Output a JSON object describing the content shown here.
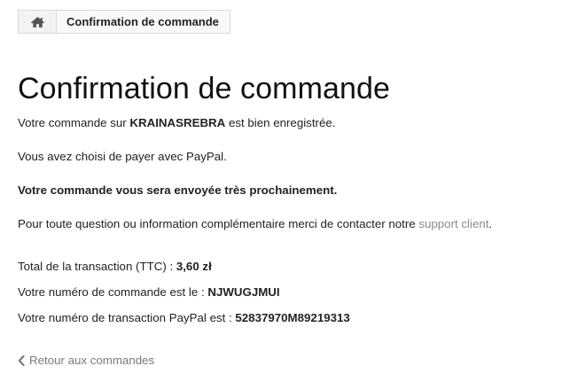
{
  "breadcrumb": {
    "home_icon": "home-icon",
    "current": "Confirmation de commande"
  },
  "title": "Confirmation de commande",
  "intro": {
    "prefix": "Votre commande sur ",
    "shop": "KRAINASREBRA",
    "suffix": " est bien enregistrée."
  },
  "payment_method": "Vous avez choisi de payer avec PayPal.",
  "shipping_note": "Votre commande vous sera envoyée très prochainement.",
  "support": {
    "prefix": "Pour toute question ou information complémentaire merci de contacter notre ",
    "link": "support client",
    "suffix": "."
  },
  "total": {
    "label": "Total de la transaction (TTC) : ",
    "value": "3,60 zł"
  },
  "order_number": {
    "label": "Votre numéro de commande est le : ",
    "value": "NJWUGJMUI"
  },
  "paypal_transaction": {
    "label": "Votre numéro de transaction PayPal est : ",
    "value": "52837970M89219313"
  },
  "back_link": {
    "icon": "chevron-left-icon",
    "label": "Retour aux commandes"
  },
  "colors": {
    "text": "#222222",
    "muted": "#8a8a8a",
    "breadcrumb_bg": "#f6f6f6",
    "breadcrumb_border": "#d9d9d9"
  }
}
